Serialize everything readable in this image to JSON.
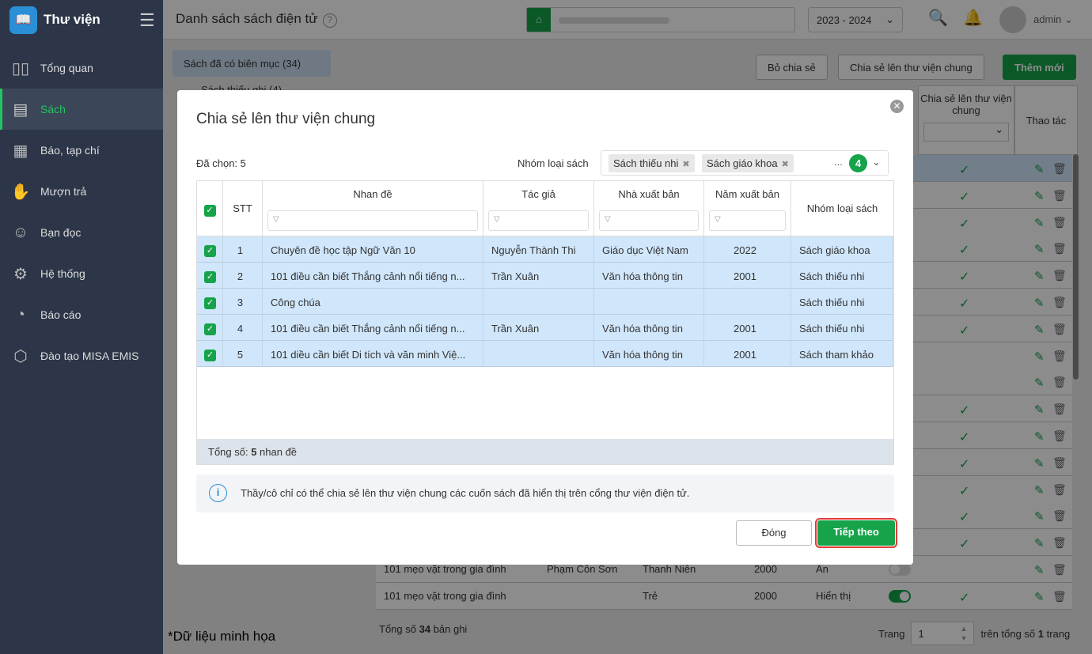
{
  "sidebar": {
    "app_name": "Thư viện",
    "items": [
      {
        "label": "Tổng quan",
        "icon": "chart-bars-icon",
        "glyph": "▯▯"
      },
      {
        "label": "Sách",
        "icon": "book-icon",
        "glyph": "▤",
        "active": true
      },
      {
        "label": "Báo, tạp chí",
        "icon": "newspaper-icon",
        "glyph": "▦"
      },
      {
        "label": "Mượn trả",
        "icon": "borrow-icon",
        "glyph": "✋"
      },
      {
        "label": "Bạn đọc",
        "icon": "reader-icon",
        "glyph": "☺"
      },
      {
        "label": "Hệ thống",
        "icon": "gear-icon",
        "glyph": "⚙"
      },
      {
        "label": "Báo cáo",
        "icon": "pie-chart-icon",
        "glyph": "◔"
      },
      {
        "label": "Đào tạo MISA EMIS",
        "icon": "box-icon",
        "glyph": "⬡"
      }
    ]
  },
  "header": {
    "title": "Danh sách sách điện tử",
    "year": "2023 - 2024",
    "user": "admin"
  },
  "tabs": {
    "cataloged": "Sách đã có biên mục (34)",
    "uncataloged": "Sách thiếu ghi (4)"
  },
  "toolbar": {
    "unshare": "Bỏ chia sẻ",
    "share": "Chia sẻ lên thư viện chung",
    "add": "Thêm mới"
  },
  "bg_table": {
    "headers": {
      "share": "Chia sẻ lên thư viện chung",
      "actions": "Thao tác"
    },
    "rows": [
      {
        "shared": true
      },
      {
        "shared": true
      },
      {
        "shared": true
      },
      {
        "shared": true
      },
      {
        "shared": true
      },
      {
        "shared": true
      },
      {
        "shared": true
      },
      {
        "shared": false
      },
      {
        "shared": false
      },
      {
        "shared": true
      },
      {
        "shared": true
      },
      {
        "shared": true
      },
      {
        "shared": true
      },
      {
        "shared": true
      },
      {
        "shared": true
      },
      {
        "title": "101 mẹo vặt trong gia đình",
        "author": "Phạm Côn Sơn",
        "publisher": "Thanh Niên",
        "year": "2000",
        "display": "Ẩn",
        "display_on": false,
        "shared": false
      },
      {
        "title": "101 mẹo vặt trong gia đình",
        "author": "",
        "publisher": "Trẻ",
        "year": "2000",
        "display": "Hiển thị",
        "display_on": true,
        "shared": true
      }
    ]
  },
  "footer": {
    "total_prefix": "Tổng số ",
    "total": "34",
    "total_suffix": " bản ghi",
    "page_label": "Trang",
    "page": "1",
    "pages_prefix": "trên tổng số ",
    "pages": "1",
    "pages_suffix": " trang"
  },
  "note": "*Dữ liệu minh họa",
  "modal": {
    "title": "Chia sẻ lên thư viện chung",
    "selected": "Đã chọn: 5",
    "group_label": "Nhóm loại sách",
    "tags": [
      "Sách thiếu nhi",
      "Sách giáo khoa"
    ],
    "more": "...",
    "more_count": "4",
    "columns": {
      "stt": "STT",
      "title": "Nhan đề",
      "author": "Tác giả",
      "publisher": "Nhà xuất bản",
      "year": "Năm xuất bản",
      "group": "Nhóm loại sách"
    },
    "rows": [
      {
        "stt": "1",
        "title": "Chuyên đề học tập Ngữ Văn 10",
        "author": "Nguyễn Thành Thi",
        "publisher": "Giáo dục Việt Nam",
        "year": "2022",
        "group": "Sách giáo khoa"
      },
      {
        "stt": "2",
        "title": "101 điều cần biết Thắng cảnh nổi tiếng n...",
        "author": "Trần Xuân",
        "publisher": "Văn hóa thông tin",
        "year": "2001",
        "group": "Sách thiếu nhi"
      },
      {
        "stt": "3",
        "title": "Công chúa",
        "author": "",
        "publisher": "",
        "year": "",
        "group": "Sách thiếu nhi"
      },
      {
        "stt": "4",
        "title": "101 điều cần biết Thắng cảnh nổi tiếng n...",
        "author": "Trần Xuân",
        "publisher": "Văn hóa thông tin",
        "year": "2001",
        "group": "Sách thiếu nhi"
      },
      {
        "stt": "5",
        "title": "101 diều cần biết Di tích và văn minh Việ...",
        "author": "",
        "publisher": "Văn hóa thông tin",
        "year": "2001",
        "group": "Sách tham khảo"
      }
    ],
    "total_prefix": "Tổng số: ",
    "total": "5",
    "total_suffix": " nhan đề",
    "info": "Thầy/cô chỉ có thể chia sẻ lên thư viện chung các cuốn sách đã hiển thị trên cổng thư viện điện tử.",
    "close_btn": "Đóng",
    "next_btn": "Tiếp theo"
  },
  "colors": {
    "accent": "#16a34a",
    "highlight": "#d0e6fb",
    "focus": "#e53935"
  }
}
